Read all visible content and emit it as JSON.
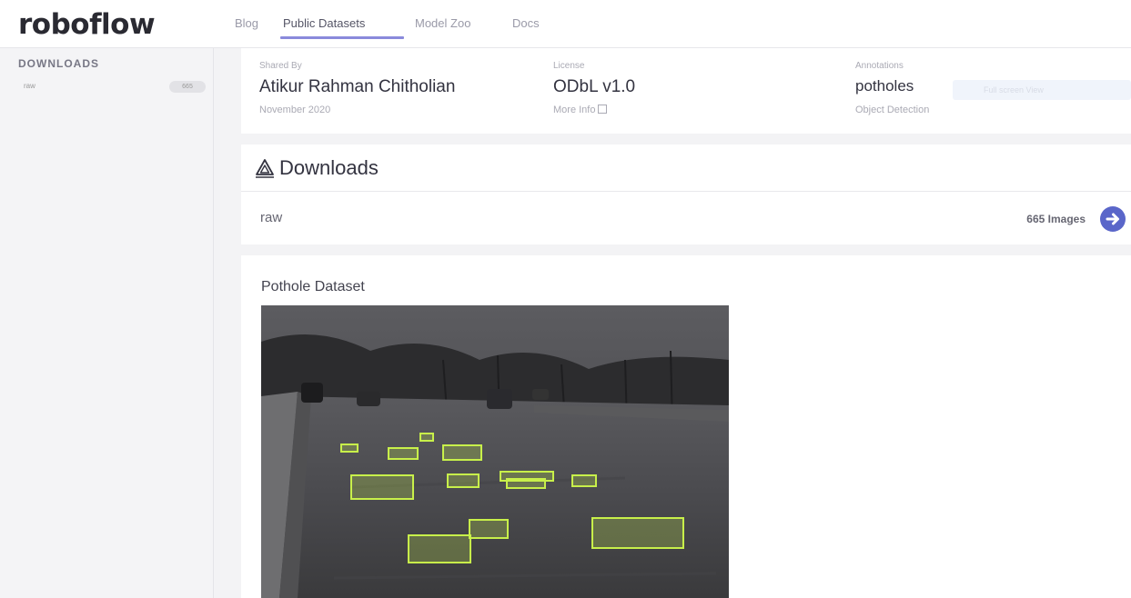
{
  "brand": {
    "logo": "roboflow"
  },
  "nav": {
    "links": [
      "Blog",
      "Public Datasets",
      "Model Zoo",
      "Docs"
    ],
    "active": "Public Datasets"
  },
  "sidebar": {
    "heading": "DOWNLOADS",
    "items": [
      {
        "label": "raw",
        "badge": "665"
      }
    ]
  },
  "info": {
    "shared_by_label": "Shared By",
    "shared_by_value": "Atikur Rahman Chitholian",
    "shared_by_date": "November 2020",
    "license_label": "License",
    "license_value": "ODbL v1.0",
    "license_link": "More Info",
    "annotations_label": "Annotations",
    "annotations_value": "potholes",
    "annotations_type": "Object Detection",
    "faint_chip_text": "Full screen View"
  },
  "downloads": {
    "title": "Downloads",
    "rows": [
      {
        "name": "raw",
        "count": "665 Images"
      }
    ]
  },
  "readme": {
    "title": "Pothole Dataset",
    "image_alt_name": "annotated-pothole-road-image"
  },
  "colors": {
    "accent": "#5a66c9",
    "bbox": "#c8f04a",
    "nav_underline": "#8a8adc"
  }
}
